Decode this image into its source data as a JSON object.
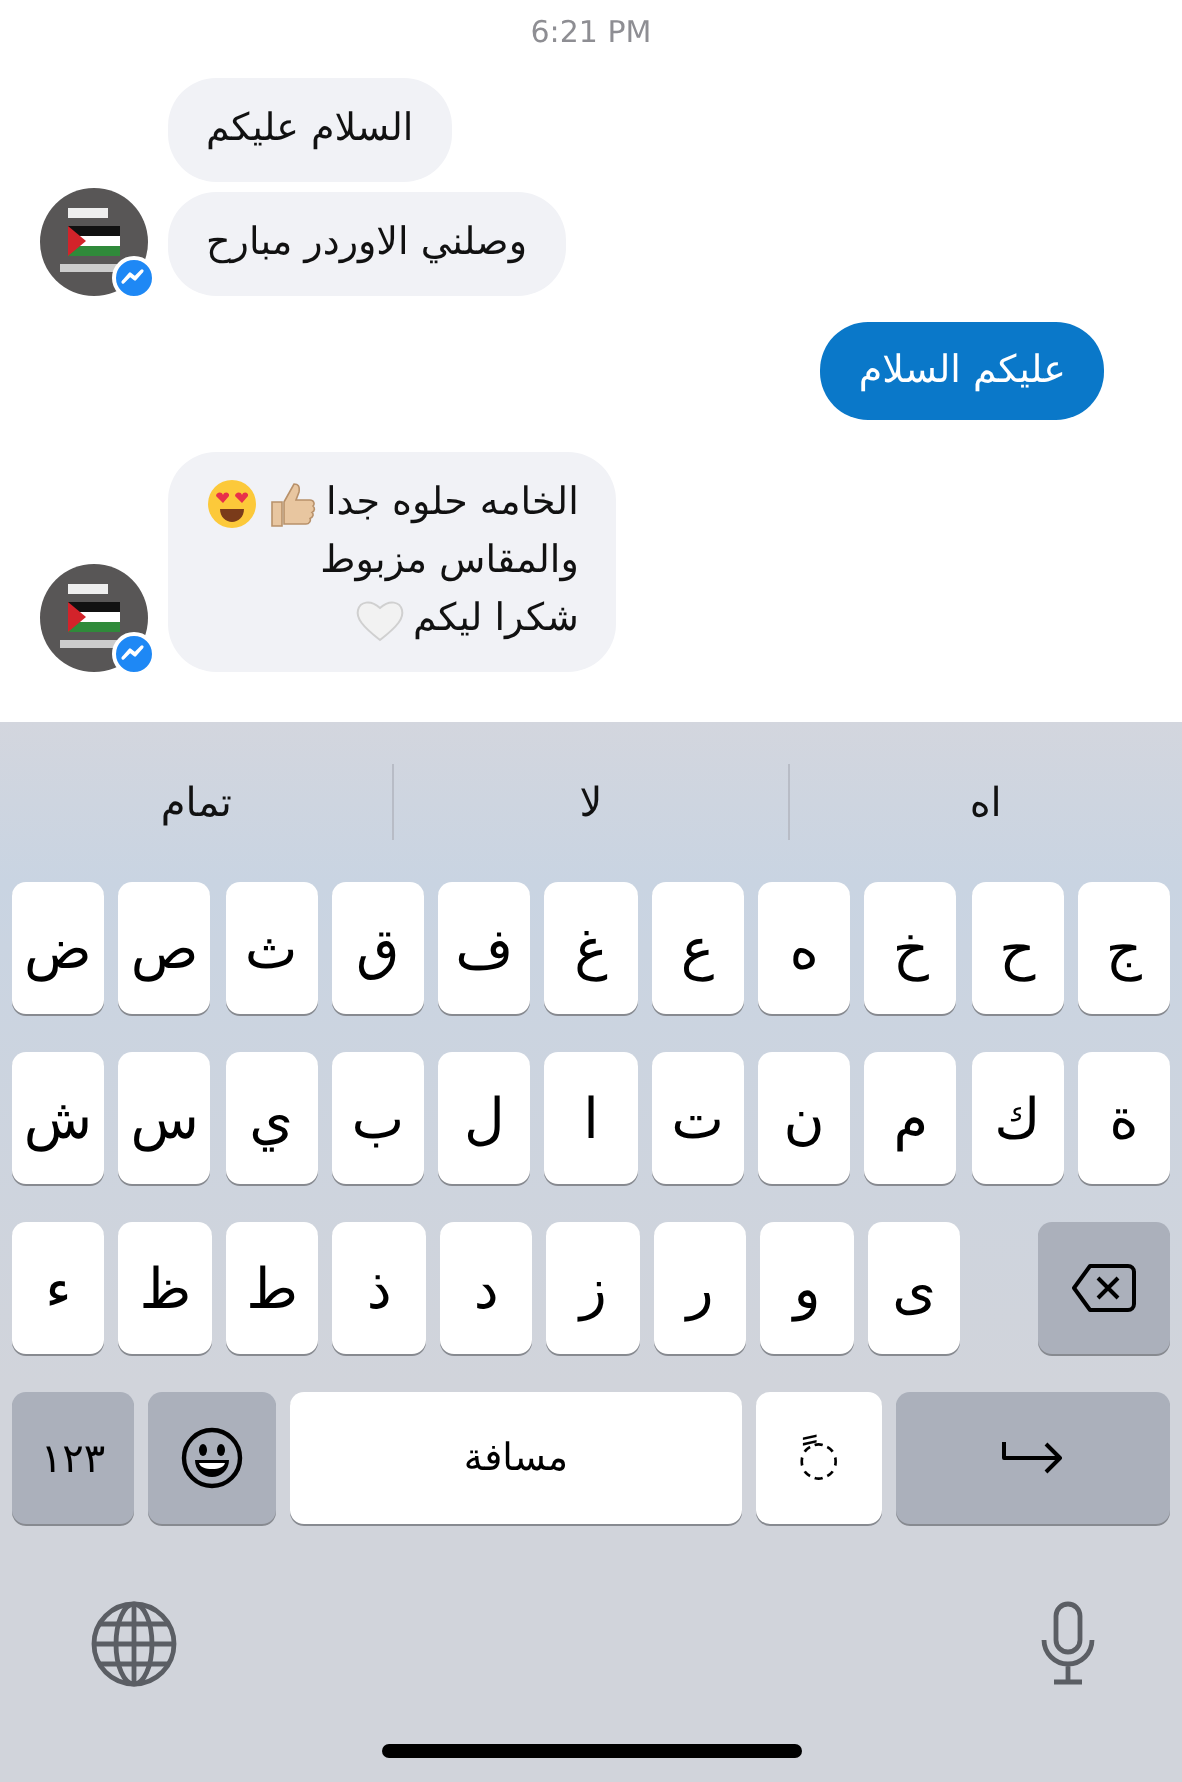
{
  "time": "6:21 PM",
  "messages": [
    {
      "kind": "received",
      "avatar": false,
      "lines": [
        {
          "text": "السلام عليكم"
        }
      ]
    },
    {
      "kind": "received",
      "avatar": true,
      "lines": [
        {
          "text": "وصلني الاوردر مبارح"
        }
      ]
    },
    {
      "kind": "sent",
      "lines": [
        {
          "text": "عليكم السلام"
        }
      ]
    },
    {
      "kind": "received",
      "avatar": true,
      "lines": [
        {
          "text": "الخامه حلوه جدا",
          "icons": [
            {
              "kind": "thumbs_up"
            },
            {
              "kind": "heart_eyes"
            }
          ]
        },
        {
          "text": "والمقاس مزبوط"
        },
        {
          "text": "شكرا ليكم",
          "icons": [
            {
              "kind": "white_heart"
            }
          ]
        }
      ]
    }
  ],
  "keyboard": {
    "suggestions": [
      "اه",
      "لا",
      "تمام"
    ],
    "rows": [
      [
        "ج",
        "ح",
        "خ",
        "ه",
        "ع",
        "غ",
        "ف",
        "ق",
        "ث",
        "ص",
        "ض"
      ],
      [
        "ة",
        "ك",
        "م",
        "ن",
        "ت",
        "ا",
        "ل",
        "ب",
        "ي",
        "س",
        "ش"
      ],
      [
        "",
        "",
        "ى",
        "و",
        "ر",
        "ز",
        "د",
        "ذ",
        "ط",
        "ظ",
        "ء"
      ]
    ],
    "bottom_row": [
      {
        "kind": "return"
      },
      {
        "kind": "diacritic",
        "label": "◌ً"
      },
      {
        "kind": "space",
        "label": "مسافة"
      },
      {
        "kind": "emoji"
      },
      {
        "kind": "numbers",
        "label": "١٢٣"
      }
    ]
  }
}
